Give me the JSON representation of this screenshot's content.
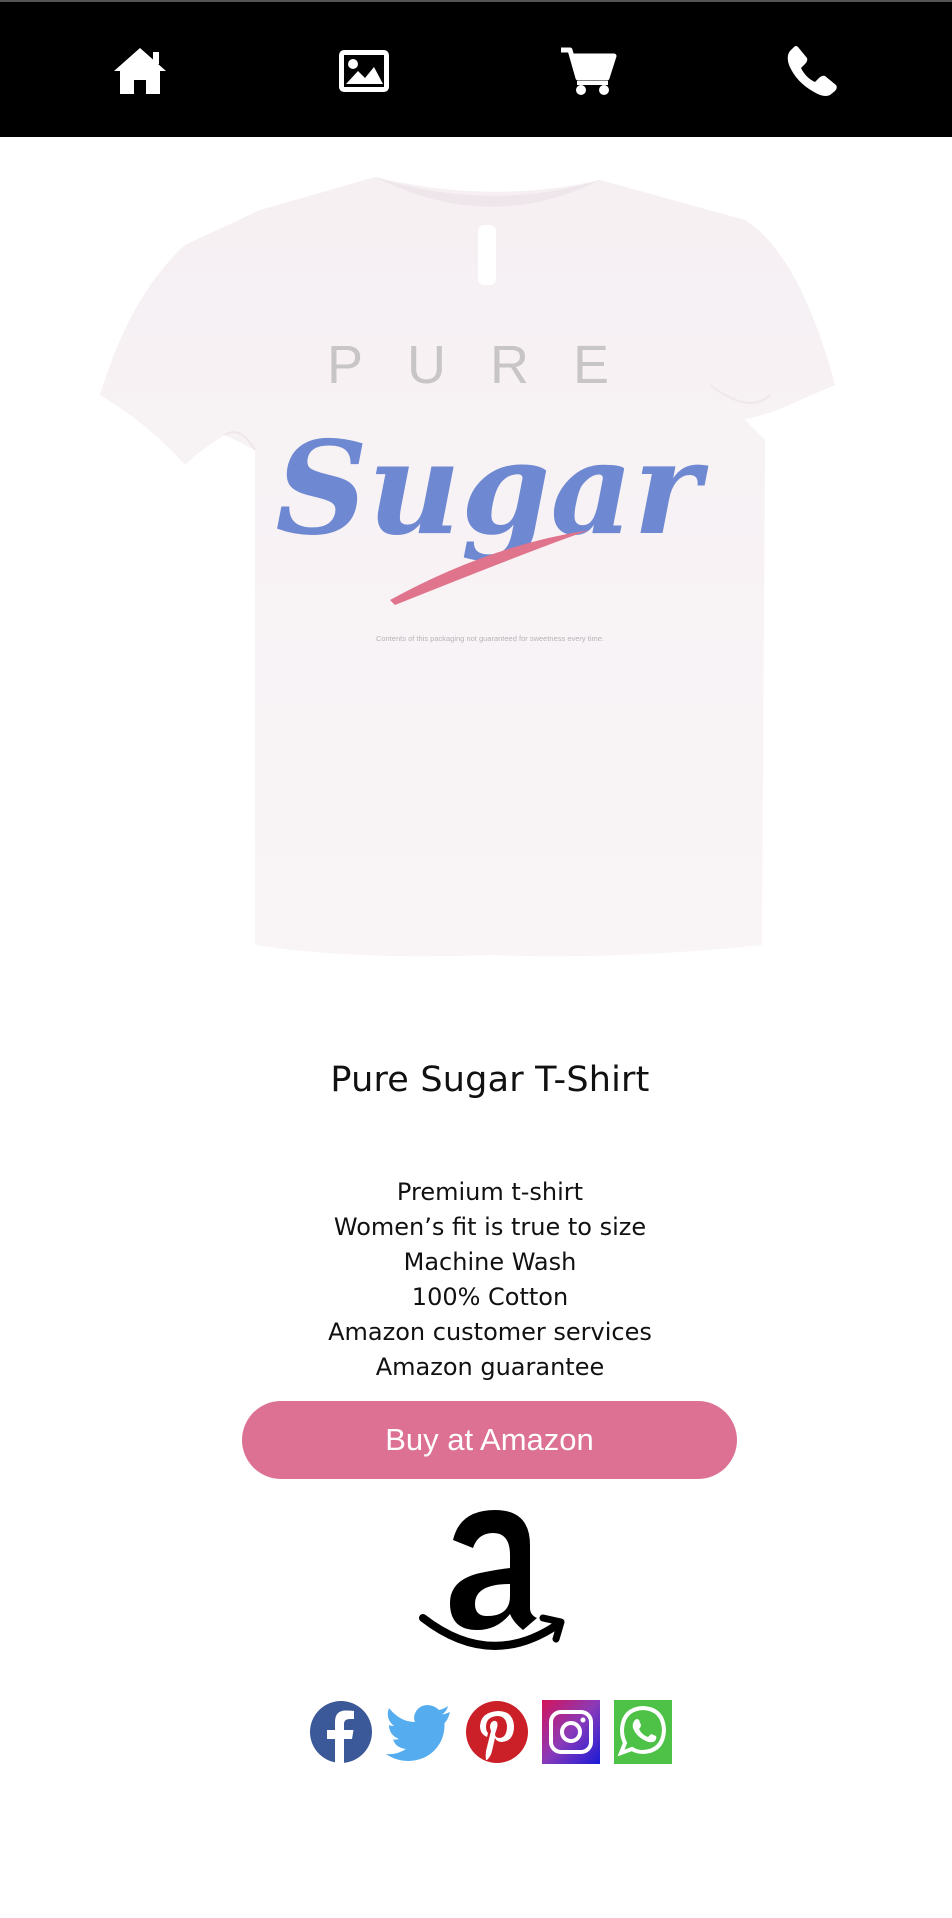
{
  "nav": {
    "items": [
      {
        "icon": "home-icon",
        "color": "#ffffff"
      },
      {
        "icon": "image-icon",
        "color": "#ffffff"
      },
      {
        "icon": "cart-icon",
        "color": "#ffffff"
      },
      {
        "icon": "phone-icon",
        "color": "#ffffff"
      }
    ],
    "background": "#000000"
  },
  "product": {
    "image": {
      "shirt_text_top": "PURE",
      "shirt_text_main": "Sugar",
      "shirt_fine_print": "Contents of this packaging not guaranteed for sweetness every time."
    },
    "title": "Pure Sugar T-Shirt",
    "features": [
      "Premium t-shirt",
      "Women’s fit is true to size",
      "Machine Wash",
      "100% Cotton",
      "Amazon customer services",
      "Amazon guarantee"
    ],
    "buy_label": "Buy at Amazon",
    "buy_color": "#dc7194"
  },
  "brand": {
    "logo": "amazon-logo"
  },
  "social": [
    {
      "icon": "facebook-icon",
      "color": "#3b5998"
    },
    {
      "icon": "twitter-icon",
      "color": "#55acee"
    },
    {
      "icon": "pinterest-icon",
      "color": "#cb2027"
    },
    {
      "icon": "instagram-icon",
      "color": "#8a3ab9"
    },
    {
      "icon": "whatsapp-icon",
      "color": "#4dc247"
    }
  ]
}
